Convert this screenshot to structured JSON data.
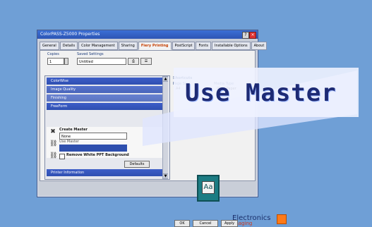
{
  "window": {
    "title": "ColorPASS-Z5000 Properties",
    "help_label": "?",
    "close_label": "×"
  },
  "tabs": [
    {
      "label": "General"
    },
    {
      "label": "Details"
    },
    {
      "label": "Color Management"
    },
    {
      "label": "Sharing"
    },
    {
      "label": "Fiery Printing"
    },
    {
      "label": "PostScript"
    },
    {
      "label": "Fonts"
    },
    {
      "label": "Installable Options"
    },
    {
      "label": "About"
    }
  ],
  "controls": {
    "copies_label": "Copies",
    "copies_value": "1",
    "saved_settings_label": "Saved Settings",
    "saved_settings_value": "Untitled",
    "shortcuts_label": "Shortcuts",
    "page_size_label": "Page Size",
    "page_size_value": "A4",
    "media_type_label": "Media Type",
    "media_type_value": "Plain Paper"
  },
  "sections": [
    {
      "label": "ColorWise"
    },
    {
      "label": "Image Quality"
    },
    {
      "label": "Finishing"
    },
    {
      "label": "FreeForm"
    },
    {
      "label": "Printer Information"
    }
  ],
  "freeform": {
    "create_master_label": "Create Master",
    "create_master_value": "None",
    "use_master_label": "Use Master",
    "use_master_value": "",
    "remove_white_label": "Remove White PPT Background",
    "defaults_button": "Defaults"
  },
  "footer": {
    "ok": "OK",
    "cancel": "Cancel",
    "apply": "Apply"
  },
  "branding": {
    "line1": "Electronics",
    "line2": "imaging"
  },
  "overlay": {
    "big_label": "Use Master"
  }
}
